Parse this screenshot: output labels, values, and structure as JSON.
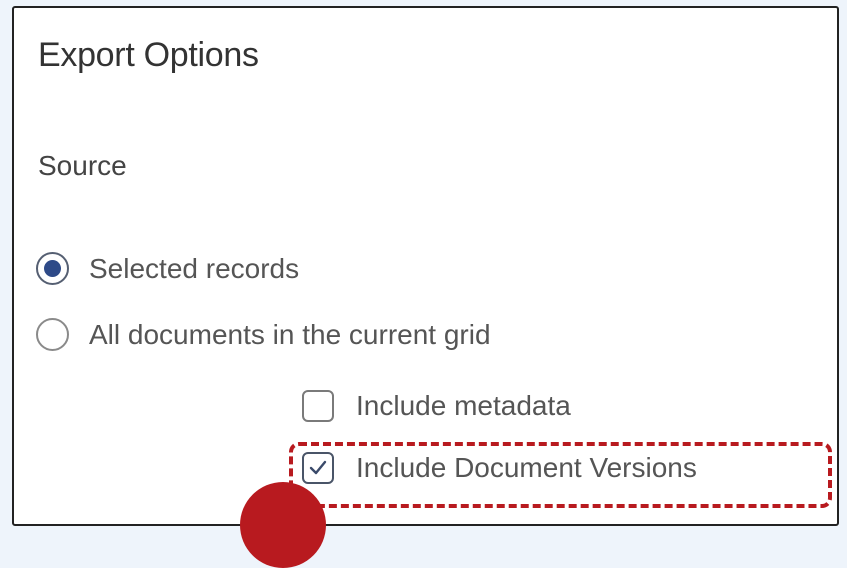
{
  "dialog": {
    "title": "Export Options",
    "source_label": "Source"
  },
  "source_options": [
    {
      "label": "Selected records",
      "checked": true
    },
    {
      "label": "All documents in the current grid",
      "checked": false
    }
  ],
  "include_options": [
    {
      "label": "Include metadata",
      "checked": false
    },
    {
      "label": "Include Document Versions",
      "checked": true
    }
  ],
  "colors": {
    "highlight": "#b81a1f",
    "radio_selected": "#2e4a88",
    "background": "#eef4fb"
  },
  "icons": {
    "radio_selected": "radio-selected-icon",
    "radio_unselected": "radio-unselected-icon",
    "checkbox_checked": "checkmark-icon",
    "checkbox_unchecked": "checkbox-empty-icon"
  }
}
